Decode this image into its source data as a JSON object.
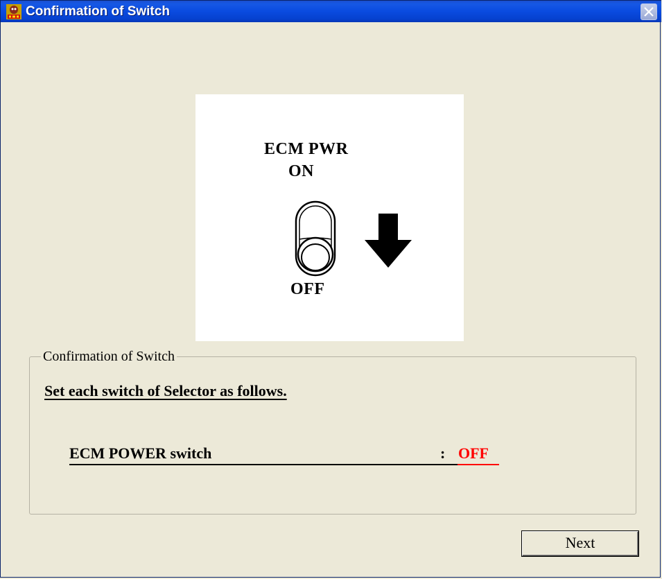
{
  "window": {
    "title": "Confirmation of Switch",
    "icon": "app-logo-icon"
  },
  "picture": {
    "label_top_line1": "ECM PWR",
    "label_top_line2": "ON",
    "label_bottom": "OFF",
    "toggle_icon": "toggle-switch-icon",
    "arrow_icon": "arrow-down-icon"
  },
  "group": {
    "title": "Confirmation of Switch",
    "instruction": "Set each switch of Selector as follows.",
    "switch_name": "ECM POWER switch",
    "separator": ":",
    "switch_value": "OFF"
  },
  "buttons": {
    "next_label": "Next"
  },
  "colors": {
    "title_bar": "#0a4be0",
    "background": "#ece9d8",
    "value_red": "#ff0000"
  }
}
